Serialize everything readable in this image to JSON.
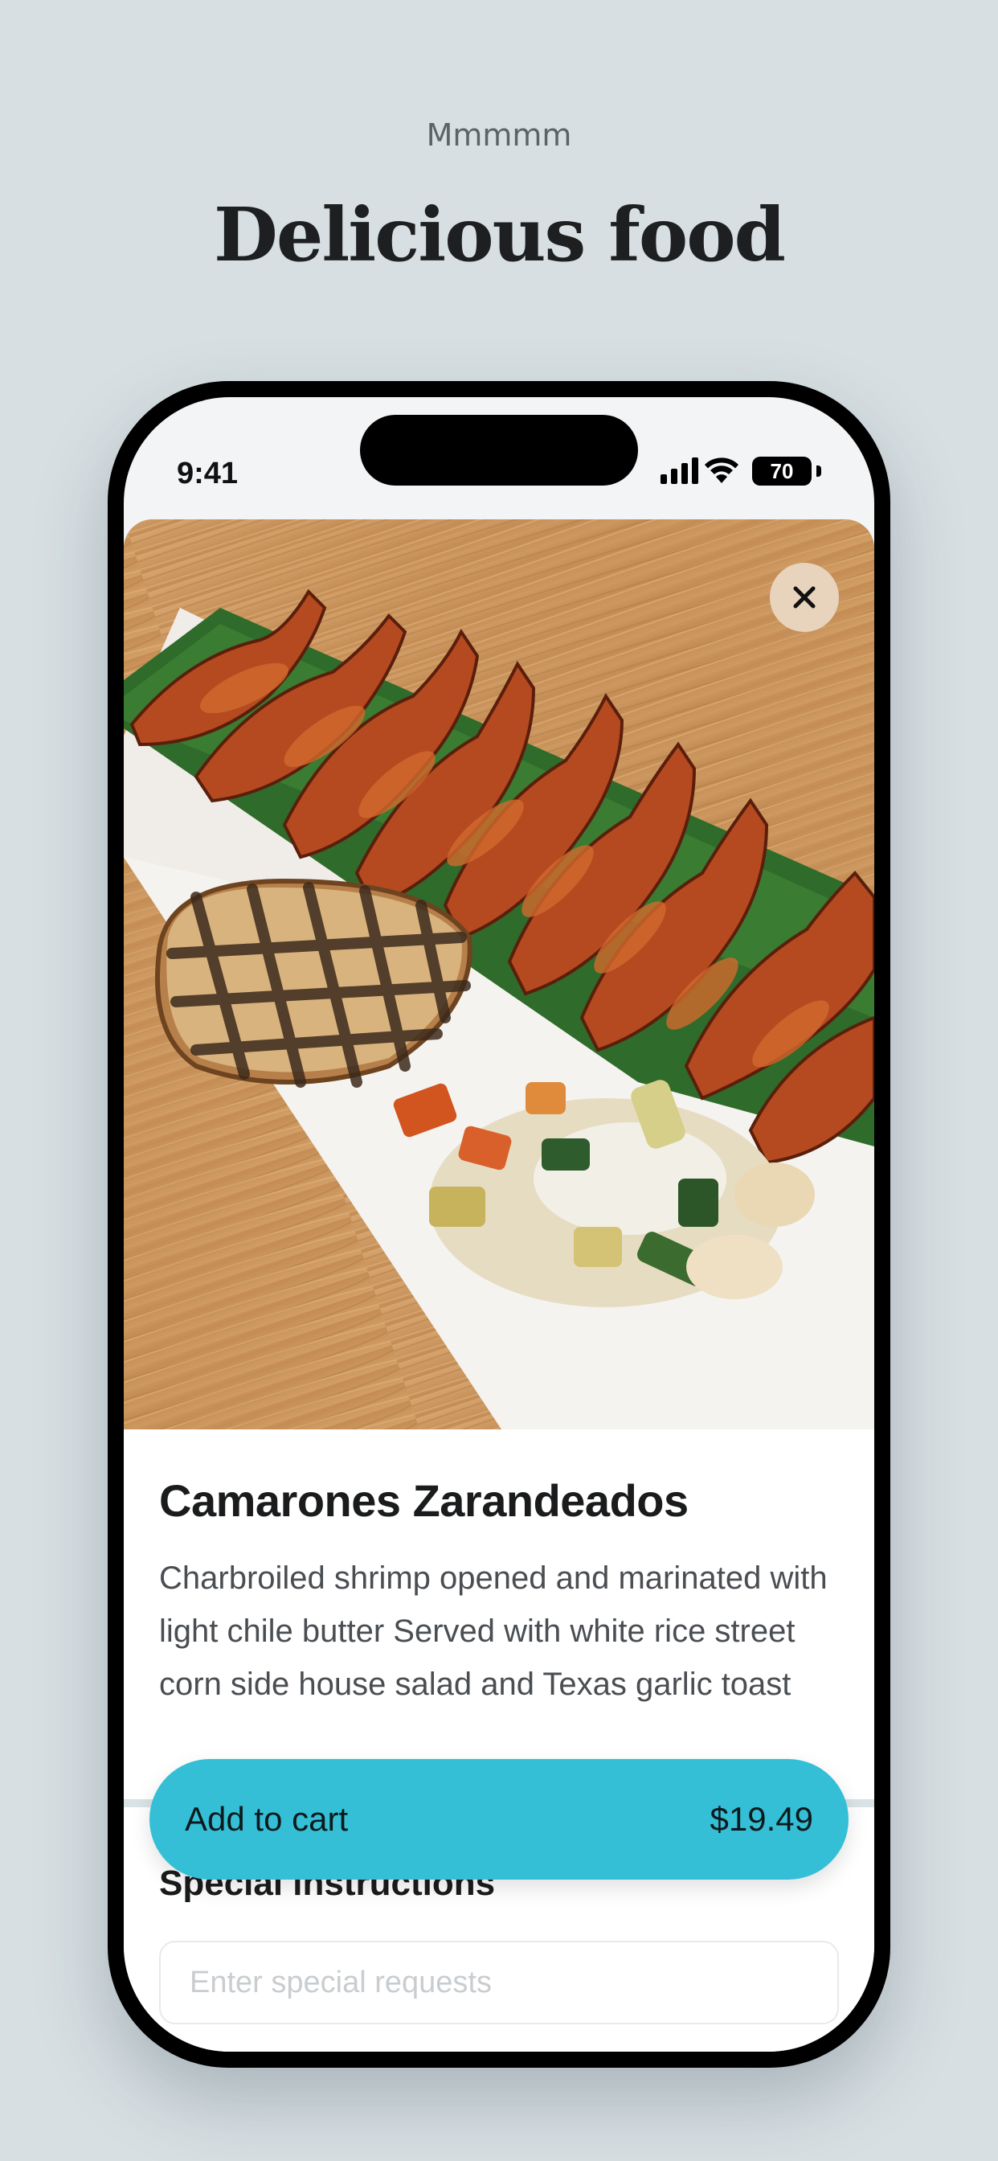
{
  "promo": {
    "eyebrow": "Mmmmm",
    "title": "Delicious food"
  },
  "status_bar": {
    "time": "9:41",
    "battery": "70"
  },
  "item": {
    "image_alt": "Grilled shrimp with toast and vegetables",
    "name": "Camarones Zarandeados",
    "description": "Charbroiled shrimp opened and marinated with light chile butter Served with white rice street corn side house salad and Texas garlic toast"
  },
  "special_instructions": {
    "title": "Special instructions",
    "placeholder": "Enter special requests"
  },
  "cart": {
    "label": "Add to cart",
    "price": "$19.49"
  },
  "colors": {
    "background": "#d7dfe2",
    "accent": "#35bfd6",
    "close_button": "#e8d3bd"
  },
  "icons": [
    "close-icon",
    "signal-icon",
    "wifi-icon",
    "battery-icon"
  ]
}
